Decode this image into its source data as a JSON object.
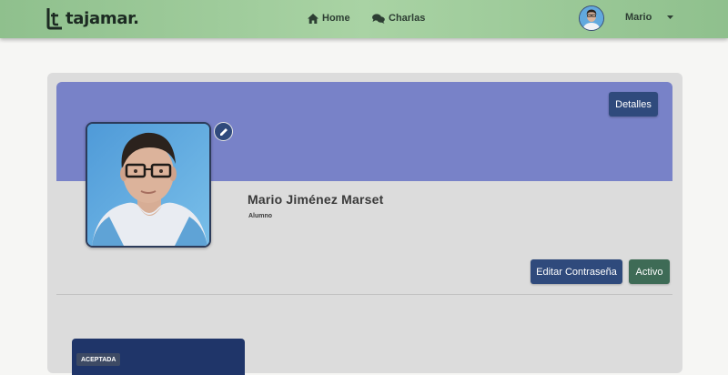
{
  "navbar": {
    "brand": "tajamar.",
    "links": [
      {
        "label": "Home",
        "icon": "home-icon"
      },
      {
        "label": "Charlas",
        "icon": "comments-icon"
      }
    ],
    "user_name": "Mario",
    "dropdown_icon": "caret-down-icon"
  },
  "profile": {
    "details_button": "Detalles",
    "edit_photo_icon": "pencil-icon",
    "full_name": "Mario Jiménez Marset",
    "role": "Alumno",
    "change_password_button": "Editar Contraseña",
    "status_button": "Activo"
  },
  "talks": [
    {
      "status": "ACEPTADA"
    }
  ],
  "colors": {
    "navbar": "#a9d3a4",
    "banner": "#7882c8",
    "primary_button": "#2f4a7c",
    "status_button": "#3e6b56",
    "talk_card": "#1f3569"
  }
}
